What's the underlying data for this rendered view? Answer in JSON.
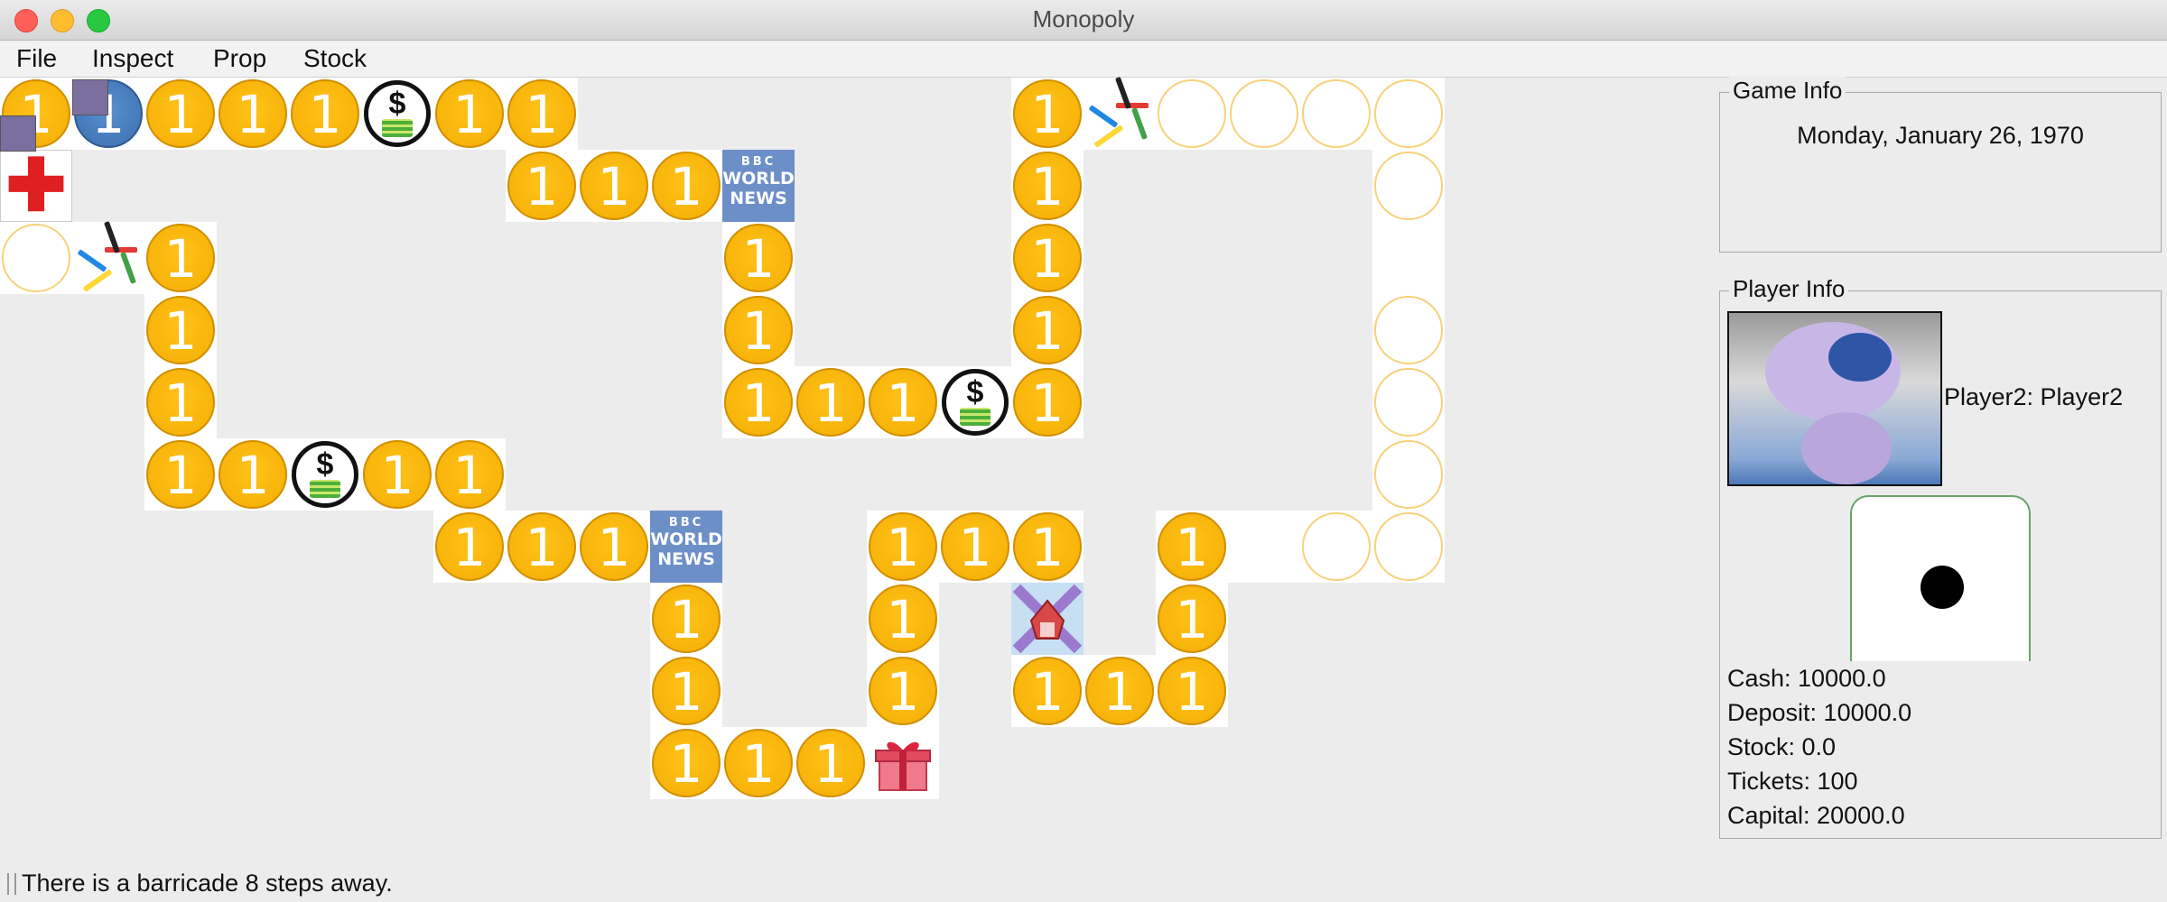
{
  "window": {
    "title": "Monopoly"
  },
  "menu": {
    "file": "File",
    "inspect": "Inspect",
    "prop": "Prop",
    "stock": "Stock"
  },
  "board": {
    "coin_label": "1",
    "bbc_top": "BBC",
    "bbc_mid": "WORLD",
    "bbc_bot": "NEWS",
    "dollar_symbol": "$"
  },
  "game_info": {
    "title": "Game Info",
    "date": "Monday, January 26, 1970"
  },
  "player_info": {
    "title": "Player Info",
    "name": "Player2: Player2",
    "dice_value": 1,
    "cash": "Cash: 10000.0",
    "deposit": "Deposit: 10000.0",
    "stock": "Stock: 0.0",
    "tickets": "Tickets: 100",
    "capital": "Capital: 20000.0"
  },
  "status": {
    "message": "There is a barricade 8 steps away."
  },
  "colors": {
    "coin": "#f8b40a",
    "empty_ring": "#f6d27a",
    "bbc": "#6d8fc8",
    "red_cross": "#e02020"
  }
}
